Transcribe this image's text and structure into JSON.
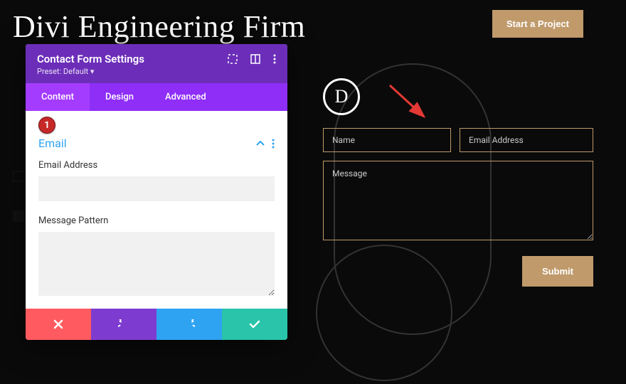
{
  "header": {
    "title": "Divi Engineering Firm",
    "cta_label": "Start a Project"
  },
  "form": {
    "name_placeholder": "Name",
    "email_placeholder": "Email Address",
    "message_placeholder": "Message",
    "submit_label": "Submit"
  },
  "logo": {
    "letter": "D"
  },
  "panel": {
    "title": "Contact Form Settings",
    "preset": "Preset: Default ▾",
    "tabs": {
      "content": "Content",
      "design": "Design",
      "advanced": "Advanced"
    },
    "badge": "1",
    "section": {
      "title": "Email",
      "email_label": "Email Address",
      "pattern_label": "Message Pattern"
    }
  }
}
